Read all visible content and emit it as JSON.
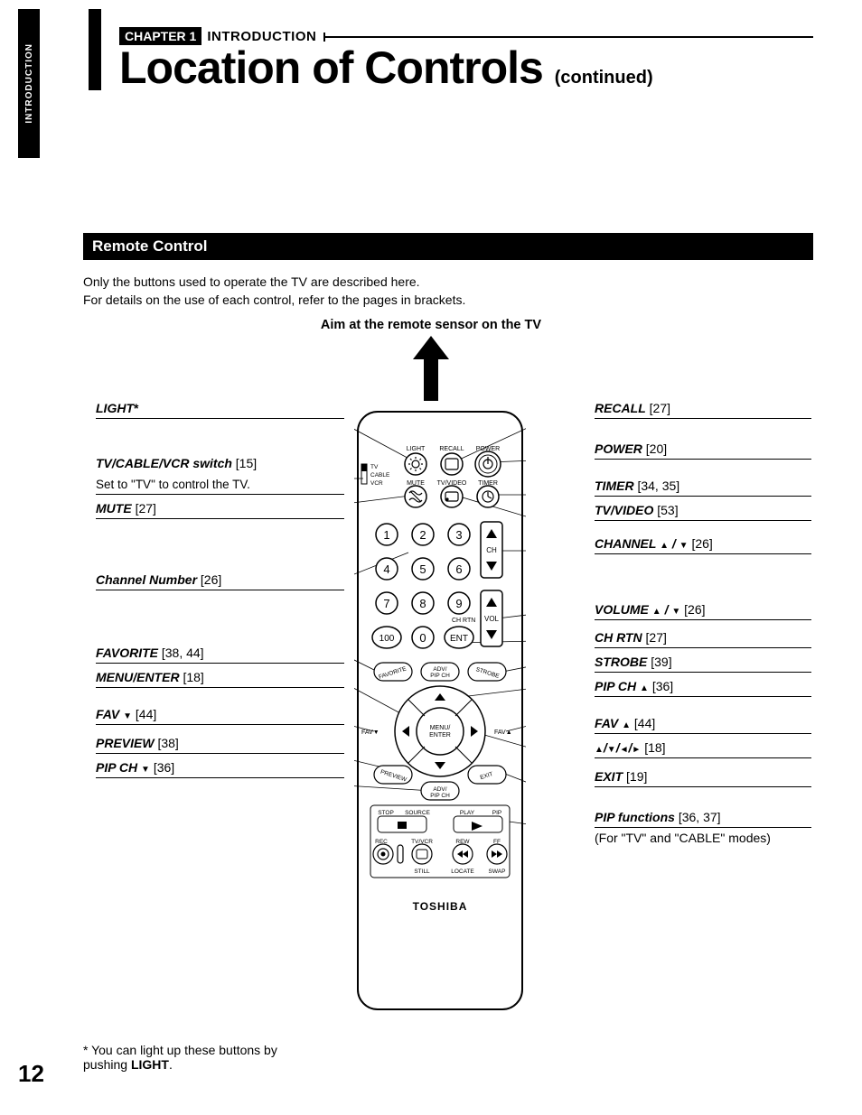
{
  "sideTab": "INTRODUCTION",
  "chapterChip": "CHAPTER 1",
  "chapterText": "INTRODUCTION",
  "title": "Location of Controls",
  "titleCont": "(continued)",
  "sectionBar": "Remote Control",
  "intro1": "Only the buttons used to operate the TV are described here.",
  "intro2": "For details on the use of each control, refer to the pages in brackets.",
  "aim": "Aim at the remote sensor on the TV",
  "left": {
    "light": {
      "label": "LIGHT",
      "suffix": "*"
    },
    "switch": {
      "label": "TV/CABLE/VCR switch",
      "pages": "[15]",
      "desc": "Set to \"TV\" to control the TV."
    },
    "mute": {
      "label": "MUTE",
      "pages": "[27]"
    },
    "chnum": {
      "label": "Channel Number",
      "pages": "[26]"
    },
    "fav": {
      "label": "FAVORITE",
      "pages": "[38, 44]"
    },
    "menu": {
      "label": "MENU/ENTER",
      "pages": "[18]"
    },
    "favdn": {
      "label": "FAV",
      "sym": "trid",
      "pages": "[44]"
    },
    "preview": {
      "label": "PREVIEW",
      "pages": "[38]"
    },
    "pipdn": {
      "label": "PIP CH",
      "sym": "trid",
      "pages": "[36]"
    }
  },
  "right": {
    "recall": {
      "label": "RECALL",
      "pages": "[27]"
    },
    "power": {
      "label": "POWER",
      "pages": "[20]"
    },
    "timer": {
      "label": "TIMER",
      "pages": "[34, 35]"
    },
    "tvvideo": {
      "label": "TV/VIDEO",
      "pages": "[53]"
    },
    "channel": {
      "label": "CHANNEL",
      "sym": "updown",
      "pages": "[26]"
    },
    "volume": {
      "label": "VOLUME",
      "sym": "updown",
      "pages": "[26]"
    },
    "chrtn": {
      "label": "CH RTN",
      "pages": "[27]"
    },
    "strobe": {
      "label": "STROBE",
      "pages": "[39]"
    },
    "pipup": {
      "label": "PIP CH",
      "sym": "tri",
      "pages": "[36]"
    },
    "favup": {
      "label": "FAV",
      "sym": "tri",
      "pages": "[44]"
    },
    "dpad": {
      "label": "",
      "sym": "dpad",
      "pages": "[18]"
    },
    "exit": {
      "label": "EXIT",
      "pages": "[19]"
    },
    "pip": {
      "label": "PIP functions",
      "pages": "[36, 37]",
      "desc": "(For \"TV\" and \"CABLE\" modes)"
    }
  },
  "remote": {
    "row1": [
      "LIGHT",
      "RECALL",
      "POWER"
    ],
    "switch": [
      "TV",
      "CABLE",
      "VCR"
    ],
    "row2": [
      "MUTE",
      "TV/VIDEO",
      "TIMER"
    ],
    "ch": "CH",
    "chrtn": "CH RTN",
    "vol": "VOL",
    "num100": "100",
    "ent": "ENT",
    "favorite": "FAVORITE",
    "advpip": "ADV/\nPIP CH",
    "strobe": "STROBE",
    "favd": "FAV▼",
    "favu": "FAV▲",
    "menu": "MENU/\nENTER",
    "preview": "PREVIEW",
    "exit": "EXIT",
    "stop": "STOP",
    "source": "SOURCE",
    "play": "PLAY",
    "pip": "PIP",
    "rec": "REC",
    "tvvcr": "TV/VCR",
    "rew": "REW",
    "ff": "FF",
    "still": "STILL",
    "locate": "LOCATE",
    "swap": "SWAP",
    "brand": "TOSHIBA"
  },
  "footnoteStar": "*",
  "footnote1": "You can light up these buttons by pushing ",
  "footnote2": "LIGHT",
  "footnote3": ".",
  "pageNumber": "12"
}
